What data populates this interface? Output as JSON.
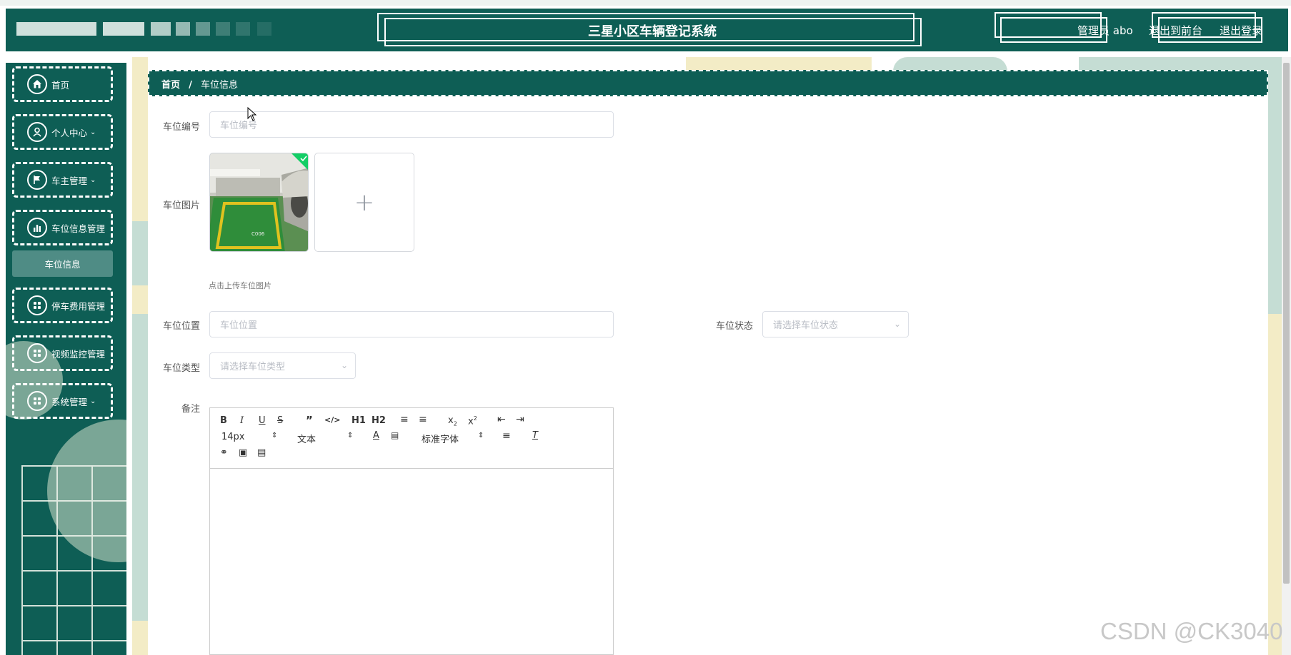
{
  "header": {
    "title": "三星小区车辆登记系统",
    "user_label": "管理员 abo",
    "front_link": "退出到前台",
    "logout_link": "退出登录"
  },
  "sidebar": {
    "items": [
      {
        "label": "首页",
        "icon": "home-icon"
      },
      {
        "label": "个人中心",
        "icon": "user-icon",
        "has_children": true
      },
      {
        "label": "车主管理",
        "icon": "flag-icon",
        "has_children": true
      },
      {
        "label": "车位信息管理",
        "icon": "chart-icon",
        "has_children": false
      },
      {
        "label": "停车费用管理",
        "icon": "grid-icon",
        "has_children": false
      },
      {
        "label": "视频监控管理",
        "icon": "grid-icon",
        "has_children": false
      },
      {
        "label": "系统管理",
        "icon": "grid-icon",
        "has_children": true
      }
    ],
    "submenu_active": "车位信息"
  },
  "breadcrumb": {
    "home": "首页",
    "separator": "/",
    "current": "车位信息"
  },
  "form": {
    "space_no_label": "车位编号",
    "space_no_placeholder": "车位编号",
    "image_label": "车位图片",
    "image_hint": "点击上传车位图片",
    "location_label": "车位位置",
    "location_placeholder": "车位位置",
    "status_label": "车位状态",
    "status_placeholder": "请选择车位状态",
    "type_label": "车位类型",
    "type_placeholder": "请选择车位类型",
    "remark_label": "备注",
    "thumb_caption": "C006"
  },
  "editor": {
    "font_size": "14px",
    "heading": "文本",
    "font_family": "标准字体",
    "h1": "H1",
    "h2": "H2"
  },
  "watermark": "CSDN @CK3040",
  "colors": {
    "primary": "#0e5e55",
    "accent_light": "#4f8c85",
    "bg_cream": "#f3ecc6",
    "bg_mint": "#c5ddd4"
  }
}
